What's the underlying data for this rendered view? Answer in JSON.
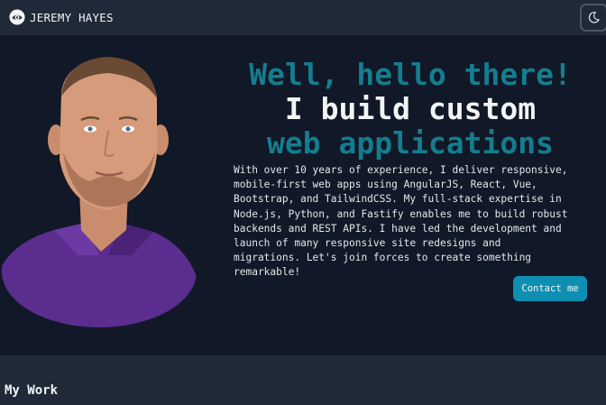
{
  "navbar": {
    "brand_name": "JEREMY HAYES",
    "logo_icon": "eye-logo-icon",
    "theme_toggle_icon": "moon-icon"
  },
  "hero": {
    "headline": {
      "line1": "Well, hello there!",
      "line2": "I build custom",
      "line3": "web applications"
    },
    "intro": "With over 10 years of experience, I deliver responsive, mobile-first web apps using AngularJS, React, Vue, Bootstrap, and TailwindCSS. My full-stack expertise in Node.js, Python, and Fastify enables me to build robust backends and REST APIs. I have led the development and launch of many responsive site redesigns and migrations. Let's join forces to create something remarkable!",
    "contact_label": "Contact me"
  },
  "work": {
    "title": "My Work"
  },
  "colors": {
    "background": "#111827",
    "navbar": "#1f2937",
    "accent_teal": "#147d8e",
    "button": "#0e8fb1",
    "shirt": "#5b2d8e"
  }
}
